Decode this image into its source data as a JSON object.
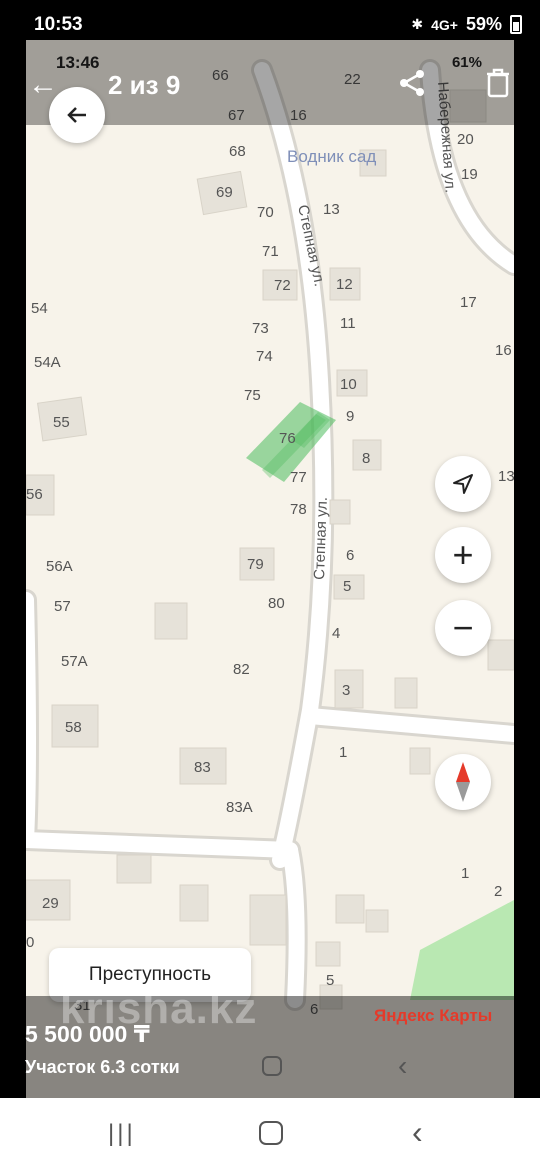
{
  "status_bar": {
    "time": "10:53",
    "bluetooth": "✱",
    "network": "4G+",
    "battery": "59%"
  },
  "inner_status": {
    "time": "13:46",
    "battery": "61%"
  },
  "viewer": {
    "counter": "2 из 9"
  },
  "map": {
    "labels": {
      "l66": "66",
      "l67": "67",
      "l68": "68",
      "l69": "69",
      "l70": "70",
      "l71": "71",
      "l72": "72",
      "l73": "73",
      "l74": "74",
      "l75": "75",
      "l76": "76",
      "l77": "77",
      "l78": "78",
      "l79": "79",
      "l80": "80",
      "l82": "82",
      "l83": "83",
      "l83a": "83А",
      "r16": "16",
      "r13": "13",
      "r12": "12",
      "r11": "11",
      "r10": "10",
      "r9": "9",
      "r8": "8",
      "r6": "6",
      "r5": "5",
      "r4": "4",
      "r3": "3",
      "r1": "1",
      "far22": "22",
      "far20": "20",
      "far19": "19",
      "far17": "17",
      "far16": "16",
      "far13": "13",
      "far1": "1",
      "far2": "2",
      "w54": "54",
      "w54a": "54А",
      "w55": "55",
      "w56": "56",
      "w56a": "56А",
      "w57": "57",
      "w57a": "57А",
      "w58": "58",
      "w29": "29",
      "w0": "0",
      "b5": "5",
      "b6": "6",
      "b31": "31",
      "vodnik": "Водник сад",
      "street1": "Степная ул.",
      "street2": "Степная ул.",
      "street3": "Набережная ул."
    },
    "crime_label": "Преступность",
    "attribution": "Яндекс Карты",
    "watermark": "krisha.kz"
  },
  "listing": {
    "price": "5 500 000 ₸",
    "subtitle": "Участок 6.3 сотки"
  },
  "colors": {
    "map_bg": "#f7f3ea",
    "plot_green": "#4cbb5c",
    "road": "#ffffff",
    "building": "#e6e2d9"
  }
}
